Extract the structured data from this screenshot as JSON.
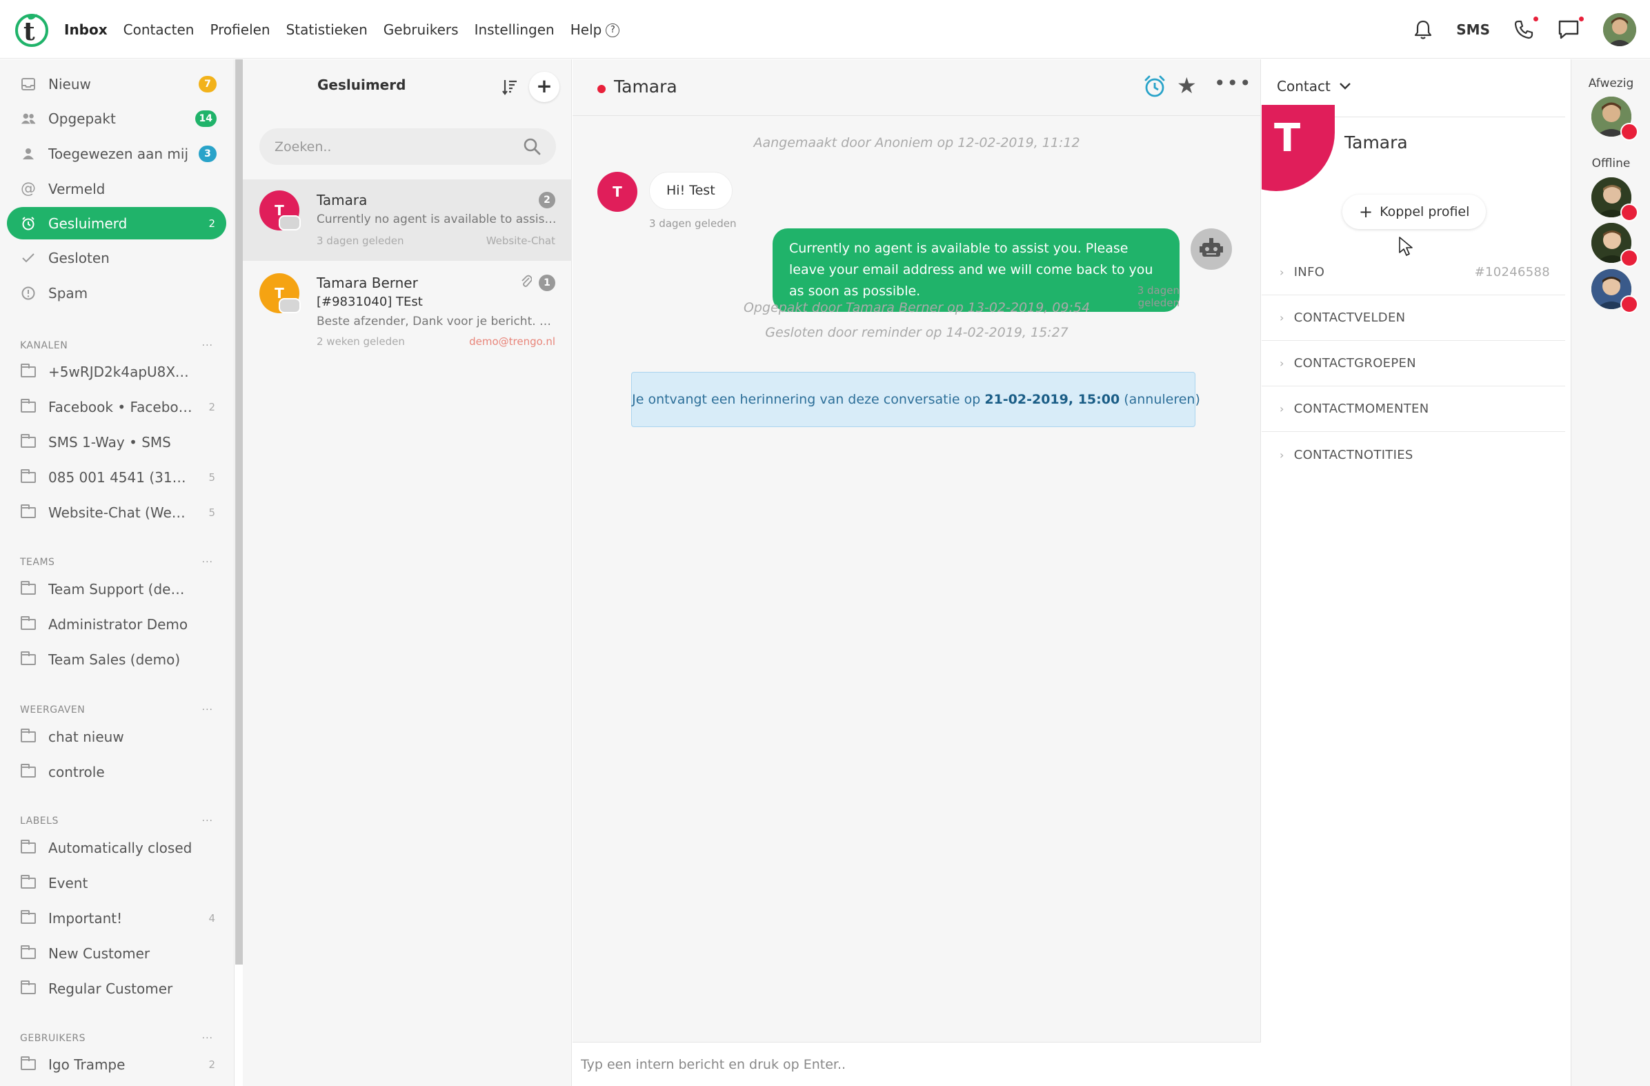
{
  "nav": {
    "items": [
      "Inbox",
      "Contacten",
      "Profielen",
      "Statistieken",
      "Gebruikers",
      "Instellingen",
      "Help"
    ],
    "help_icon": "?",
    "sms_label": "SMS",
    "icons": [
      "bell-icon",
      "phone-icon",
      "chat-icon"
    ]
  },
  "sidebar": {
    "inbox": [
      {
        "label": "Nieuw",
        "badge": "7",
        "badge_color": "#f2b21a",
        "icon": "inbox-icon"
      },
      {
        "label": "Opgepakt",
        "badge": "14",
        "badge_color": "#20b36a",
        "icon": "users-icon"
      },
      {
        "label": "Toegewezen aan mij",
        "badge": "3",
        "badge_color": "#29a3c9",
        "icon": "user-icon"
      },
      {
        "label": "Vermeld",
        "icon": "at-icon"
      },
      {
        "label": "Gesluimerd",
        "count": "2",
        "active": true,
        "icon": "alarm-icon"
      },
      {
        "label": "Gesloten",
        "icon": "check-icon"
      },
      {
        "label": "Spam",
        "icon": "warning-icon"
      }
    ],
    "sections": {
      "kanalen": {
        "title": "KANALEN",
        "items": [
          {
            "label": "+5wRJD2k4apU8XTr0...",
            "count": ""
          },
          {
            "label": "Facebook • Facebook",
            "count": "2"
          },
          {
            "label": "SMS 1-Way • SMS",
            "count": ""
          },
          {
            "label": "085 001 4541 (3185...",
            "count": "5"
          },
          {
            "label": "Website-Chat (Web-ch...",
            "count": "5"
          }
        ]
      },
      "teams": {
        "title": "TEAMS",
        "items": [
          {
            "label": "Team Support (demo)",
            "count": ""
          },
          {
            "label": "Administrator Demo",
            "count": ""
          },
          {
            "label": "Team Sales (demo)",
            "count": ""
          }
        ]
      },
      "weergaven": {
        "title": "WEERGAVEN",
        "items": [
          {
            "label": "chat nieuw",
            "count": ""
          },
          {
            "label": "controle",
            "count": ""
          }
        ]
      },
      "labels": {
        "title": "LABELS",
        "items": [
          {
            "label": "Automatically closed",
            "count": ""
          },
          {
            "label": "Event",
            "count": ""
          },
          {
            "label": "Important!",
            "count": "4"
          },
          {
            "label": "New Customer",
            "count": ""
          },
          {
            "label": "Regular Customer",
            "count": ""
          }
        ]
      },
      "gebruikers": {
        "title": "GEBRUIKERS",
        "items": [
          {
            "label": "Igo Trampe",
            "count": "2"
          }
        ]
      }
    },
    "dots": "···"
  },
  "convlist": {
    "title": "Gesluimerd",
    "add_label": "+",
    "search_placeholder": "Zoeken..",
    "conversations": [
      {
        "initial": "T",
        "avatar_color": "#e01e5a",
        "name": "Tamara",
        "subject": "",
        "preview": "Currently no agent is available to assist y...",
        "time": "3 dagen geleden",
        "source": "Website-Chat",
        "count": "2",
        "selected": true
      },
      {
        "initial": "T",
        "avatar_color": "#f5a312",
        "name": "Tamara Berner",
        "subject": "[#9831040] TEst",
        "preview": "Beste afzender, Dank voor je bericht. Wij k...",
        "time": "2 weken geleden",
        "source": "demo@trengo.nl",
        "source_color": "#e8857a",
        "count": "1",
        "has_attachment": true
      }
    ]
  },
  "chat": {
    "name": "Tamara",
    "created": "Aangemaakt door Anoniem op 12-02-2019, 11:12",
    "in_initial": "T",
    "in_message": "Hi! Test",
    "in_time": "3 dagen geleden",
    "out_message": "Currently no agent is available to assist you. Please leave your email address and we will come back to you as soon as possible.",
    "out_time": "3 dagen geleden",
    "picked_up": "Opgepakt door Tamara Berner op 13-02-2019, 09:54",
    "closed": "Gesloten door reminder op 14-02-2019, 15:27",
    "reminder_text": "Je ontvangt een herinnering van deze conversatie op",
    "reminder_date": "21-02-2019, 15:00",
    "reminder_cancel": "(annuleren)",
    "input_placeholder": "Typ een intern bericht en druk op Enter.."
  },
  "contact": {
    "dropdown": "Contact",
    "initial": "T",
    "name": "Tamara",
    "link_profile": "Koppel profiel",
    "sections": [
      {
        "label": "INFO",
        "value": "#10246588"
      },
      {
        "label": "CONTACTVELDEN",
        "value": ""
      },
      {
        "label": "CONTACTGROEPEN",
        "value": ""
      },
      {
        "label": "CONTACTMOMENTEN",
        "value": ""
      },
      {
        "label": "CONTACTNOTITIES",
        "value": ""
      }
    ]
  },
  "agents": {
    "away_label": "Afwezig",
    "offline_label": "Offline"
  },
  "colors": {
    "accent": "#20b36a",
    "danger": "#e8203a",
    "contact_avatar": "#e01e5a"
  }
}
